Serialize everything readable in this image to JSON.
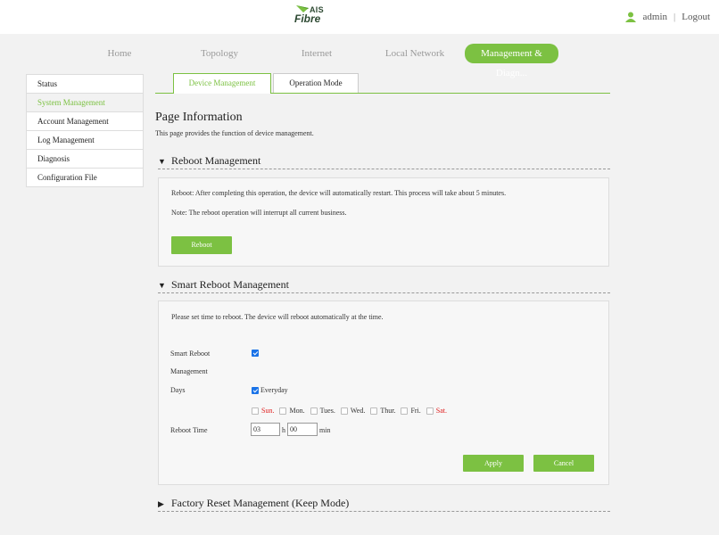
{
  "brand": {
    "ais": "AIS",
    "fibre": "Fibre",
    "accent": "#7cc142"
  },
  "user": {
    "icon": "user-icon",
    "name": "admin",
    "separator": "|",
    "logout": "Logout"
  },
  "nav": {
    "items": [
      "Home",
      "Topology",
      "Internet",
      "Local Network",
      "Management & Diagn..."
    ],
    "active": 4
  },
  "sidebar": {
    "items": [
      "Status",
      "System Management",
      "Account Management",
      "Log Management",
      "Diagnosis",
      "Configuration File"
    ],
    "active": 1
  },
  "tabs": [
    "Device Management",
    "Operation Mode"
  ],
  "page": {
    "title": "Page Information",
    "desc": "This page provides the function of device management."
  },
  "reboot": {
    "title": "Reboot Management",
    "info": "Reboot: After completing this operation, the device will automatically restart. This process will take about 5 minutes.",
    "note": "Note: The reboot operation will interrupt all current business.",
    "button": "Reboot"
  },
  "smart": {
    "title": "Smart Reboot Management",
    "info": "Please set time to reboot. The device will reboot automatically at the time.",
    "label_smart_1": "Smart Reboot",
    "label_smart_2": "Management",
    "smart_checked": true,
    "label_days": "Days",
    "everyday": "Everyday",
    "everyday_checked": true,
    "days": [
      "Sun.",
      "Mon.",
      "Tues.",
      "Wed.",
      "Thur.",
      "Fri.",
      "Sat."
    ],
    "label_time": "Reboot Time",
    "hour": "03",
    "hour_unit": "h",
    "minute": "00",
    "minute_unit": "min",
    "apply": "Apply",
    "cancel": "Cancel"
  },
  "factory": {
    "title": "Factory Reset Management (Keep Mode)"
  }
}
